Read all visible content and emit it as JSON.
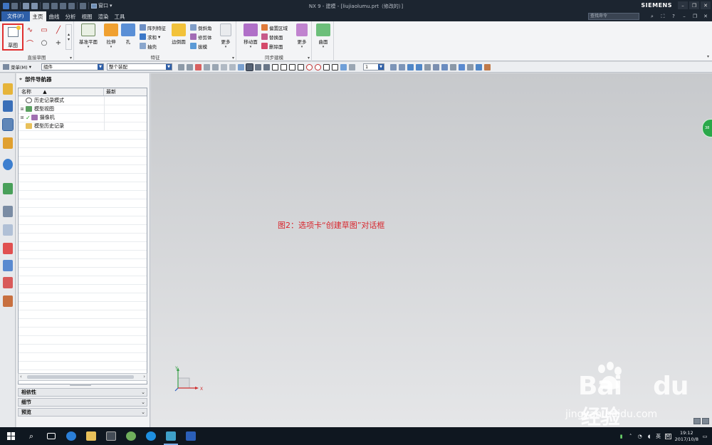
{
  "window": {
    "title": "NX 9 - 建模 - [liujiaolumu.prt（修改的）]",
    "brand": "SIEMENS",
    "quick_access_window_label": "窗口"
  },
  "menubar": {
    "file": "文件(F)",
    "tabs": [
      "主页",
      "曲线",
      "分析",
      "视图",
      "渲染",
      "工具"
    ],
    "active_tab": "主页",
    "search_placeholder": "查找命令"
  },
  "ribbon": {
    "direct_sketch": {
      "label": "直接草图",
      "sketch_button": "草图"
    },
    "feature": {
      "label": "特征",
      "datum_plane": "基准平面",
      "extrude": "拉伸",
      "hole": "孔",
      "pattern_feature": "阵列特征",
      "unite": "求和",
      "shell": "抽壳",
      "edge_blend": "边倒圆",
      "chamfer": "倒斜角",
      "trim_body": "修剪体",
      "draft": "拔模",
      "more": "更多"
    },
    "sync": {
      "label": "同步建模",
      "move_face": "移动面",
      "offset_region": "偏置区域",
      "replace_face": "替换面",
      "delete_face": "删除面",
      "more": "更多"
    },
    "surface": {
      "label": "曲面"
    }
  },
  "selbar": {
    "menu": "菜单(M)",
    "filter_value": "组件",
    "scope_value": "整个装配",
    "layer_value": "1"
  },
  "navigator": {
    "title": "部件导航器",
    "col_name": "名称",
    "col_latest": "最新",
    "items": [
      {
        "label": "历史记录模式",
        "icon": "clock-icon"
      },
      {
        "label": "模型视图",
        "icon": "views-icon"
      },
      {
        "label": "摄像机",
        "icon": "camera-icon"
      },
      {
        "label": "模型历史记录",
        "icon": "folder-icon"
      }
    ],
    "panels": [
      "相依性",
      "细节",
      "预览"
    ]
  },
  "graphics": {
    "caption": "图2：选项卡“创建草图”对话框",
    "axis_x": "X",
    "axis_y": "Y",
    "green_badge": "38",
    "watermark_brand": "Bai",
    "watermark_brand2": "du",
    "watermark_cn": "经验",
    "watermark_url": "jingyan.baidu.com"
  },
  "taskbar": {
    "ime": "英",
    "ime2": "M",
    "time": "19:12",
    "date": "2017/10/8"
  },
  "colors": {
    "accent": "#2e5fa8",
    "highlight_border": "#e03030",
    "caption": "#d8262d",
    "titlebar": "#1c2530"
  }
}
